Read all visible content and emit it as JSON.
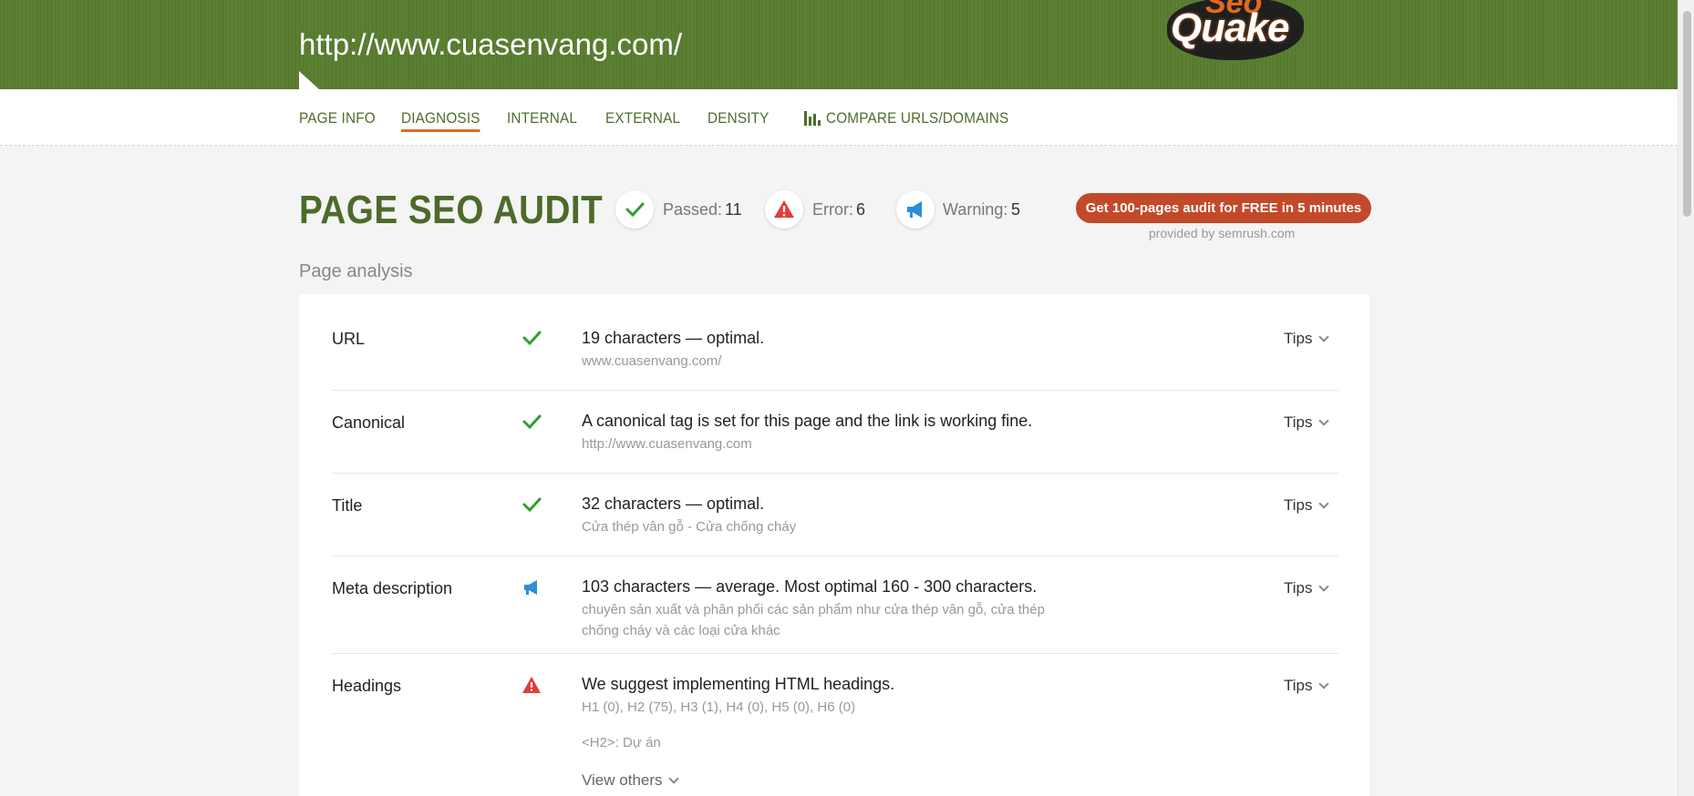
{
  "header": {
    "url": "http://www.cuasenvang.com/",
    "logo_top": "Seo",
    "logo_bottom": "Quake"
  },
  "nav": {
    "tabs": [
      "PAGE INFO",
      "DIAGNOSIS",
      "INTERNAL",
      "EXTERNAL",
      "DENSITY"
    ],
    "compare": "COMPARE URLS/DOMAINS",
    "active_tab": "DIAGNOSIS"
  },
  "audit": {
    "title": "PAGE SEO AUDIT",
    "passed_label": "Passed:",
    "passed_value": "11",
    "error_label": "Error:",
    "error_value": "6",
    "warning_label": "Warning:",
    "warning_value": "5",
    "cta": "Get 100-pages audit for FREE in 5 minutes",
    "provided": "provided by  semrush.com"
  },
  "section_label": "Page analysis",
  "rows": [
    {
      "name": "URL",
      "status": "passed",
      "main": "19 characters — optimal.",
      "sub": "www.cuasenvang.com/",
      "tips": "Tips"
    },
    {
      "name": "Canonical",
      "status": "passed",
      "main": "A canonical tag is set for this page and the link is working fine.",
      "sub": "http://www.cuasenvang.com",
      "tips": "Tips"
    },
    {
      "name": "Title",
      "status": "passed",
      "main": "32 characters — optimal.",
      "sub": "Cửa thép vân gỗ - Cửa chống cháy",
      "tips": "Tips"
    },
    {
      "name": "Meta description",
      "status": "warning",
      "main": "103 characters — average. Most optimal 160 - 300 characters.",
      "sub": "chuyên sản xuất và phân phối các sản phẩm như cửa thép vân gỗ, cửa thép",
      "sub2": "chống cháy và các loại cửa khác",
      "tips": "Tips"
    },
    {
      "name": "Headings",
      "status": "error",
      "main": "We suggest implementing HTML headings.",
      "sub": "H1 (0), H2 (75), H3 (1), H4 (0), H5 (0), H6 (0)",
      "sub2": "<H2>: Dự án",
      "tips": "Tips"
    }
  ],
  "view_others": "View others",
  "colors": {
    "header_green": "#5b7f32",
    "accent_orange": "#e36a1e",
    "cta_red": "#c2492a",
    "pass_green": "#2f9e2f",
    "error_red": "#e23b3b",
    "warning_blue": "#2a8fd6"
  }
}
